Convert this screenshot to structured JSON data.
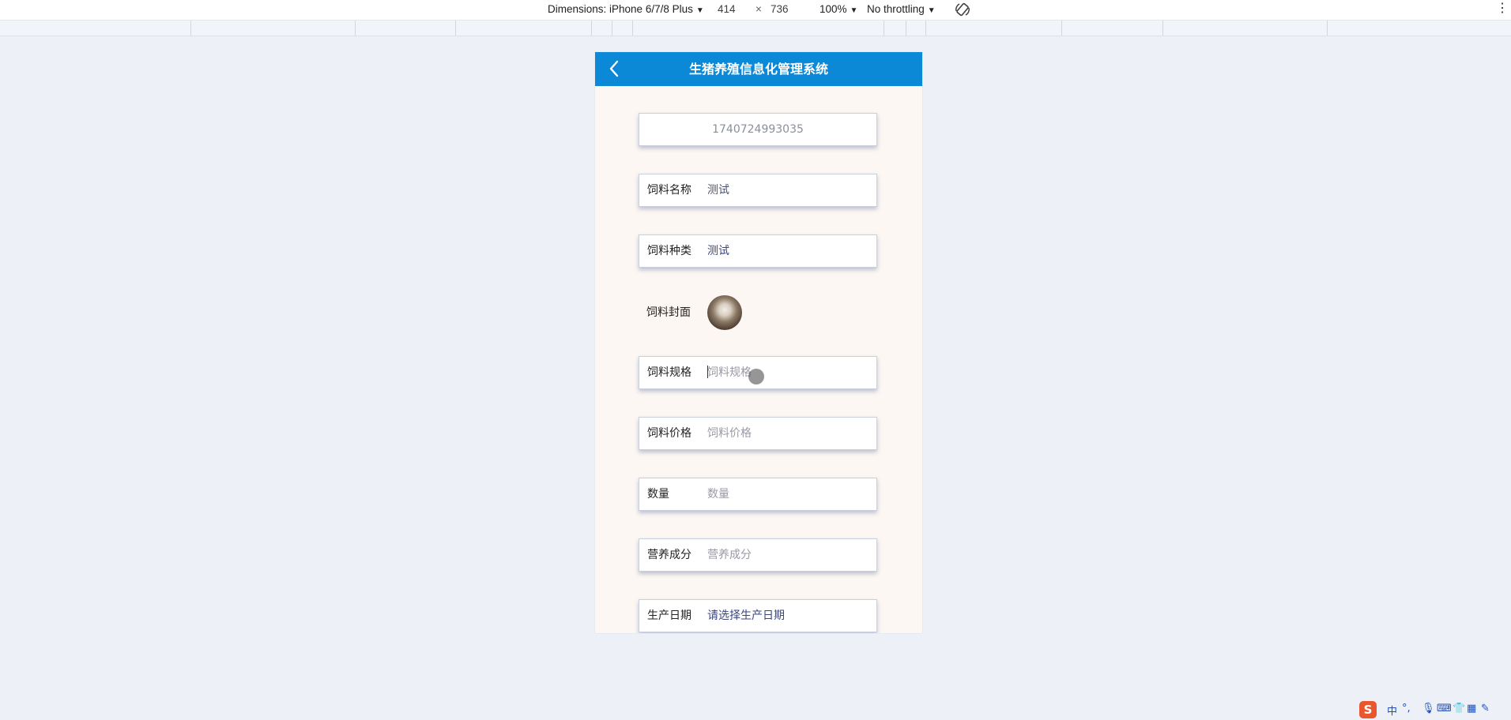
{
  "devtools": {
    "dimensions_label": "Dimensions: iPhone 6/7/8 Plus",
    "width": "414",
    "times": "×",
    "height": "736",
    "zoom": "100%",
    "throttling": "No throttling",
    "menu": "⋮"
  },
  "app": {
    "title": "生猪养殖信息化管理系统"
  },
  "form": {
    "id_value": "1740724993035",
    "feed_name": {
      "label": "饲料名称",
      "value": "测试"
    },
    "feed_type": {
      "label": "饲料种类",
      "value": "测试"
    },
    "feed_cover": {
      "label": "饲料封面"
    },
    "feed_spec": {
      "label": "饲料规格",
      "placeholder": "饲料规格"
    },
    "feed_price": {
      "label": "饲料价格",
      "placeholder": "饲料价格"
    },
    "quantity": {
      "label": "数量",
      "placeholder": "数量"
    },
    "nutrition": {
      "label": "营养成分",
      "placeholder": "营养成分"
    },
    "production_date": {
      "label": "生产日期",
      "value": "请选择生产日期"
    }
  },
  "tray": {
    "logo": "S",
    "ime_lang": "中",
    "punct": "°,"
  },
  "colors": {
    "header": "#0b88d6",
    "page_bg": "#edf1f7",
    "form_bg": "#fcf7f3"
  }
}
